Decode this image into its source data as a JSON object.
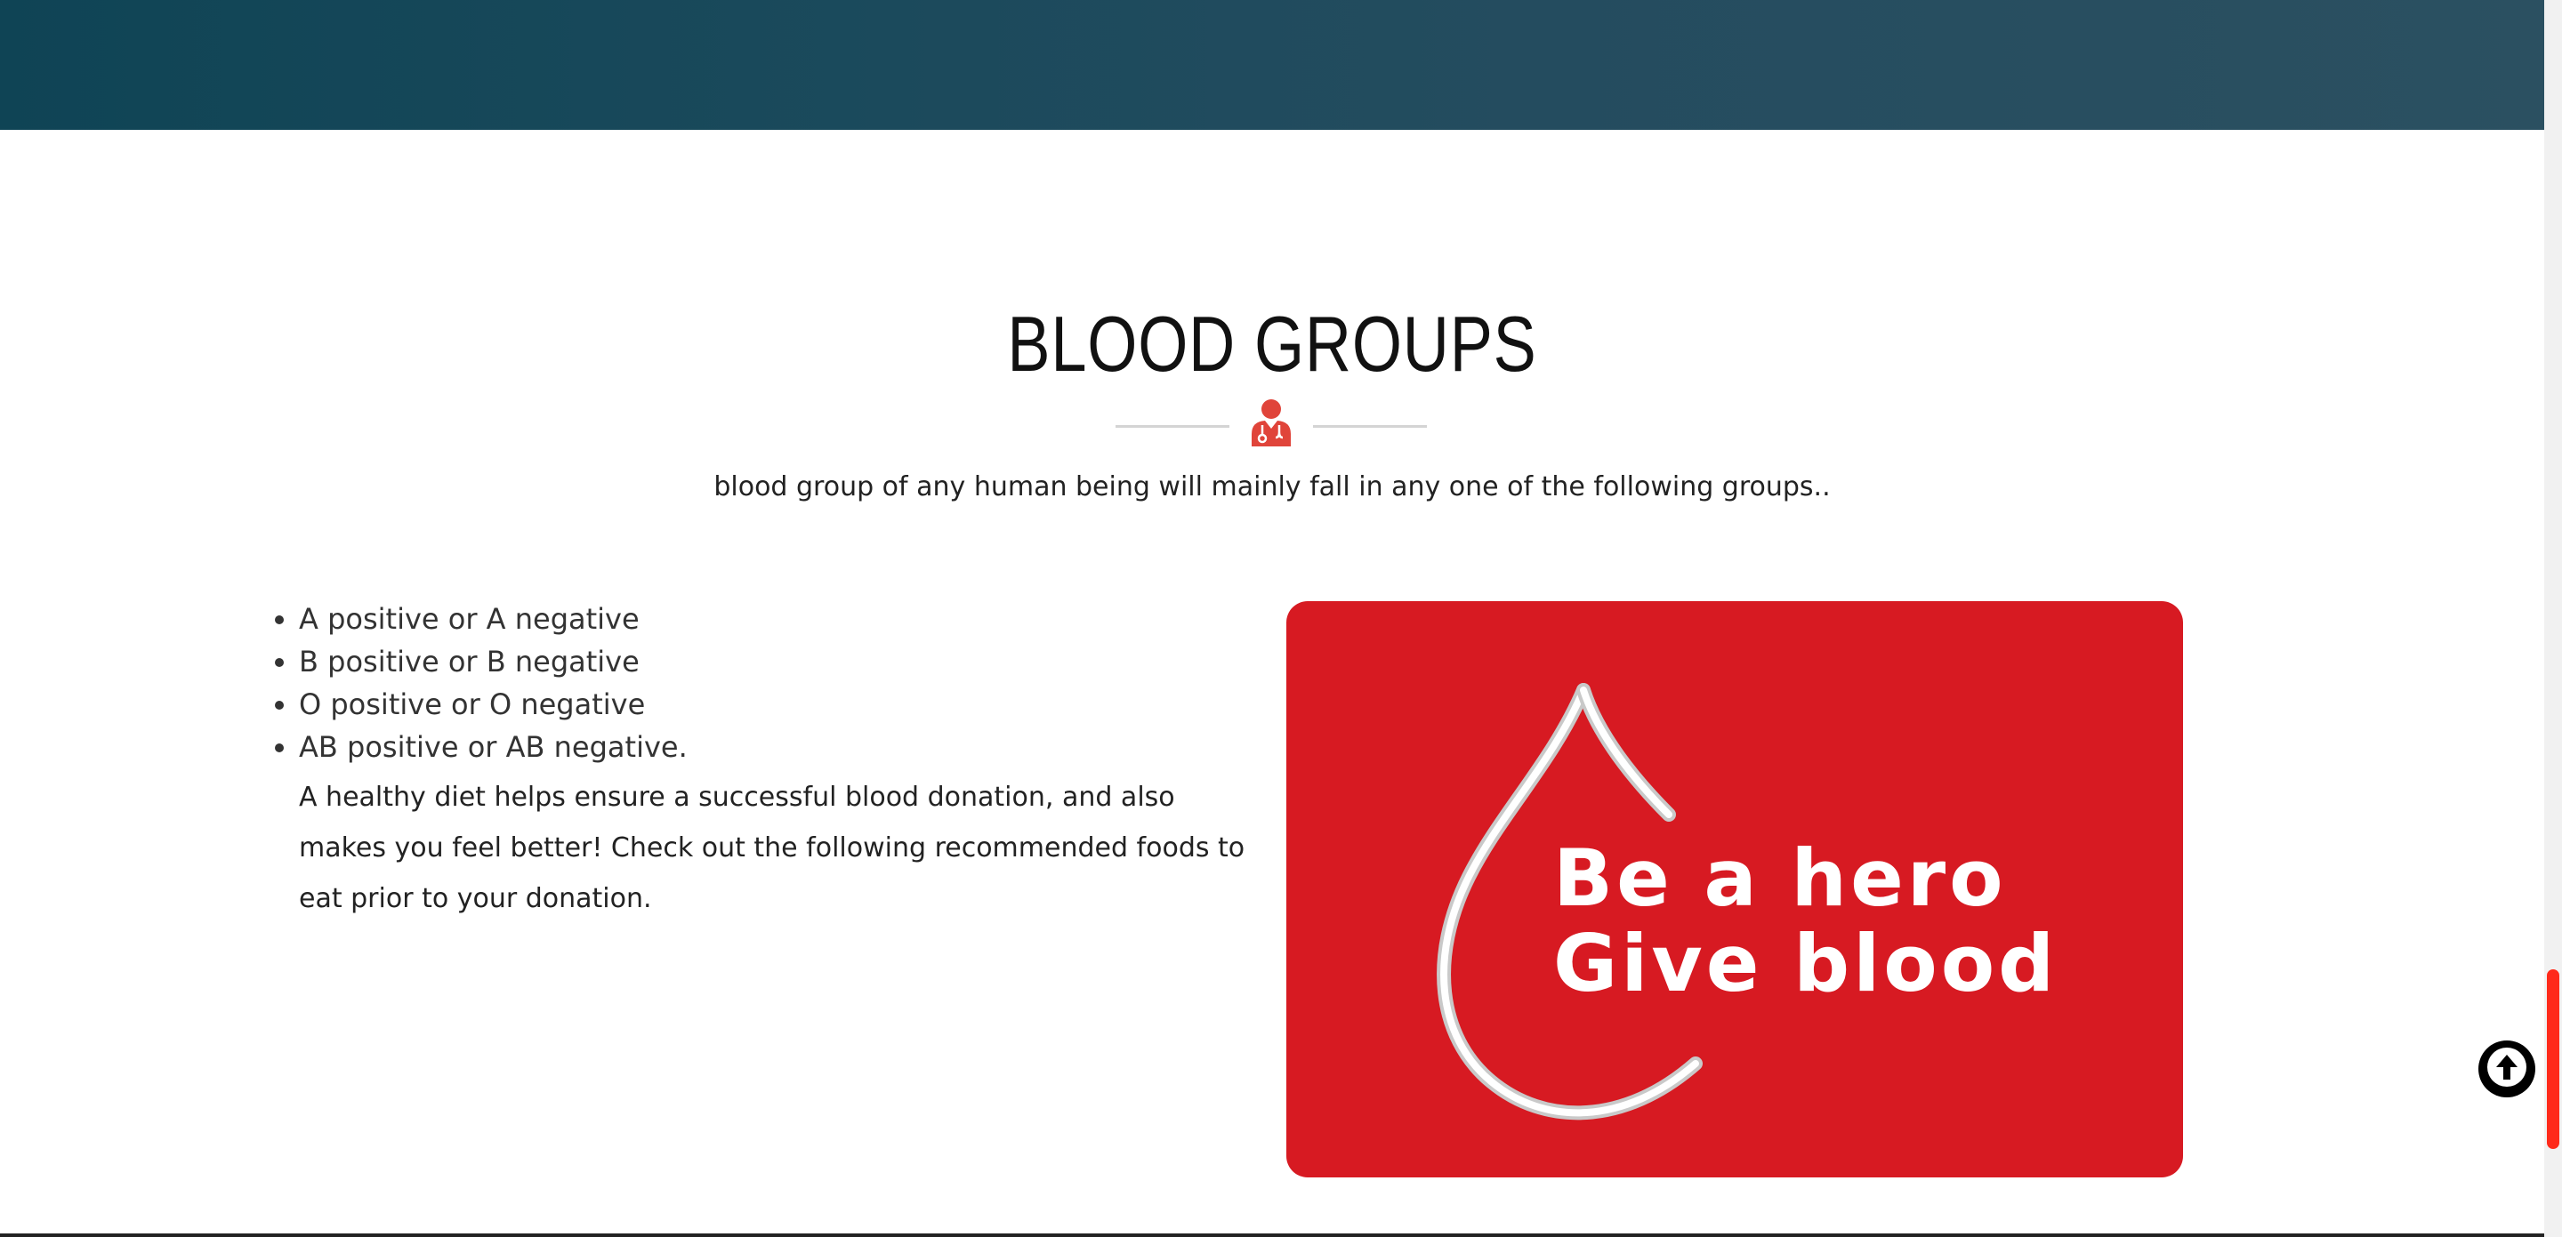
{
  "section": {
    "title": "BLOOD GROUPS",
    "subtitle": "blood group of any human being will mainly fall in any one of the following groups..",
    "icon": "doctor-icon"
  },
  "groups": [
    {
      "label": "A positive or A negative"
    },
    {
      "label": "B positive or B negative"
    },
    {
      "label": "O positive or O negative"
    },
    {
      "label": "AB positive or AB negative."
    }
  ],
  "diet_text": "A healthy diet helps ensure a successful blood donation, and also makes you feel better! Check out the following recommended foods to eat prior to your donation.",
  "hero_image": {
    "line1": "Be a hero",
    "line2": "Give blood",
    "background_color": "#d71a22"
  },
  "scroll_top": {
    "icon": "arrow-up-icon"
  },
  "colors": {
    "banner": "#1b4a5c",
    "accent": "#e0443a",
    "scrollbar_thumb": "#ff2a1a"
  }
}
